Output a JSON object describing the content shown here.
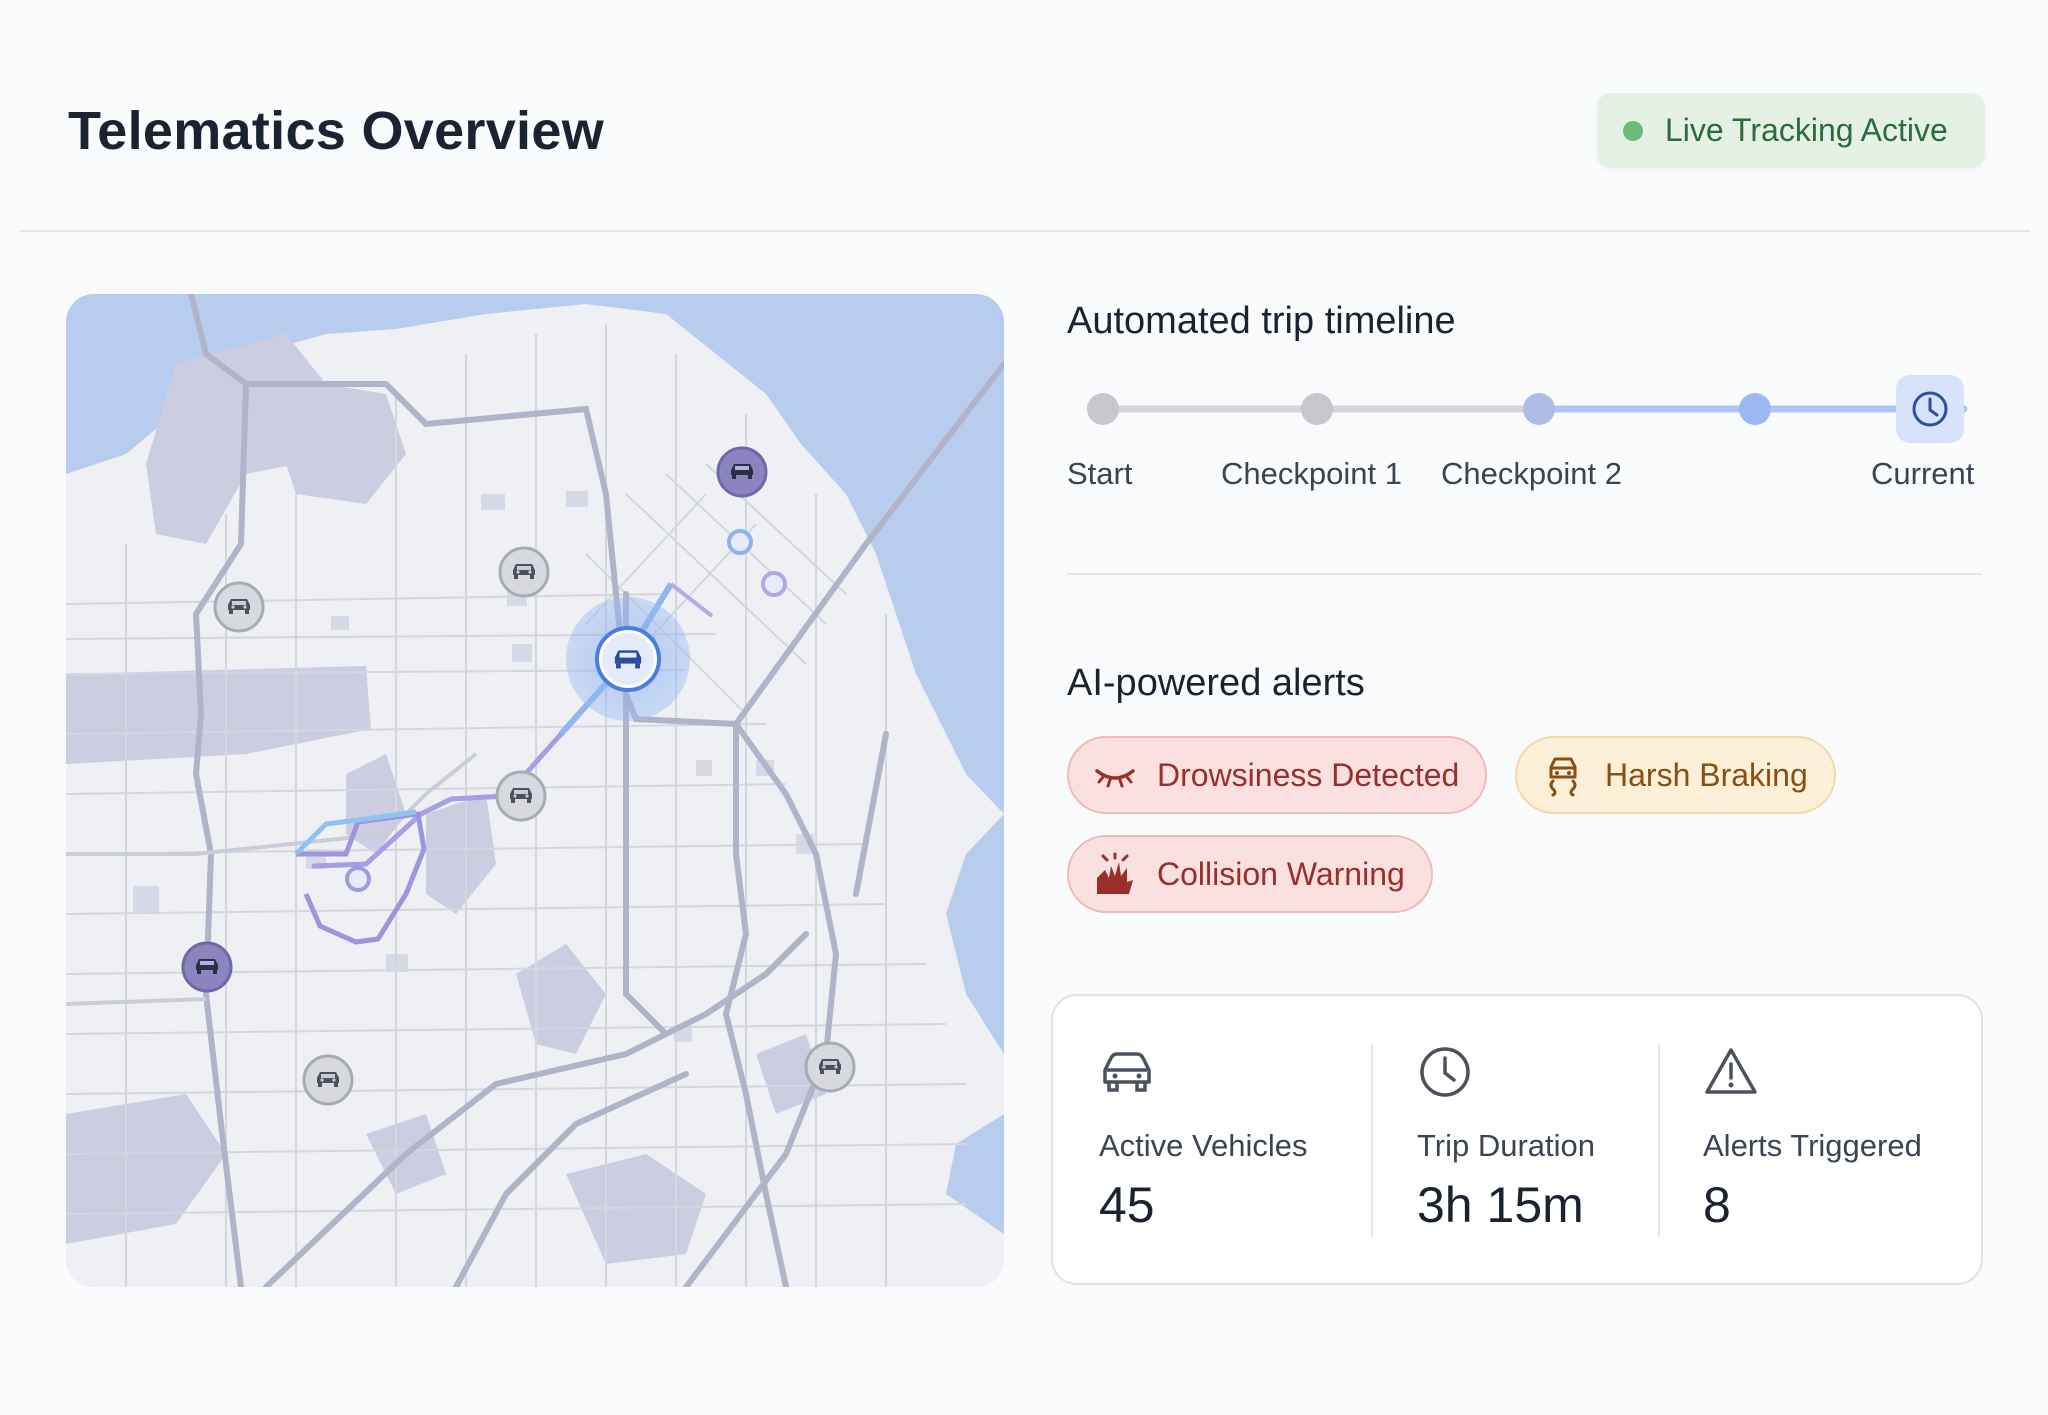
{
  "header": {
    "title": "Telematics Overview",
    "status_badge": "Live Tracking Active",
    "status_color": "#6cbb79"
  },
  "map": {
    "vehicle_markers": [
      "car-icon",
      "car-icon",
      "car-icon",
      "car-icon",
      "car-icon",
      "car-icon",
      "car-icon",
      "car-icon"
    ],
    "active_vehicle_icon": "car-icon"
  },
  "timeline": {
    "title": "Automated trip timeline",
    "steps": [
      {
        "label": "Start"
      },
      {
        "label": "Checkpoint 1"
      },
      {
        "label": "Checkpoint 2"
      },
      {
        "label": ""
      },
      {
        "label": "Current",
        "icon": "clock-icon"
      }
    ]
  },
  "alerts": {
    "title": "AI-powered alerts",
    "items": [
      {
        "label": "Drowsiness Detected",
        "icon": "closed-eye-icon",
        "severity": "red"
      },
      {
        "label": "Harsh Braking",
        "icon": "braking-car-icon",
        "severity": "amber"
      },
      {
        "label": "Collision Warning",
        "icon": "collision-icon",
        "severity": "red"
      }
    ]
  },
  "stats": {
    "active_vehicles": {
      "label": "Active Vehicles",
      "value": "45",
      "icon": "car-outline-icon"
    },
    "trip_duration": {
      "label": "Trip Duration",
      "value": "3h 15m",
      "icon": "clock-icon"
    },
    "alerts_triggered": {
      "label": "Alerts Triggered",
      "value": "8",
      "icon": "warning-icon"
    }
  }
}
